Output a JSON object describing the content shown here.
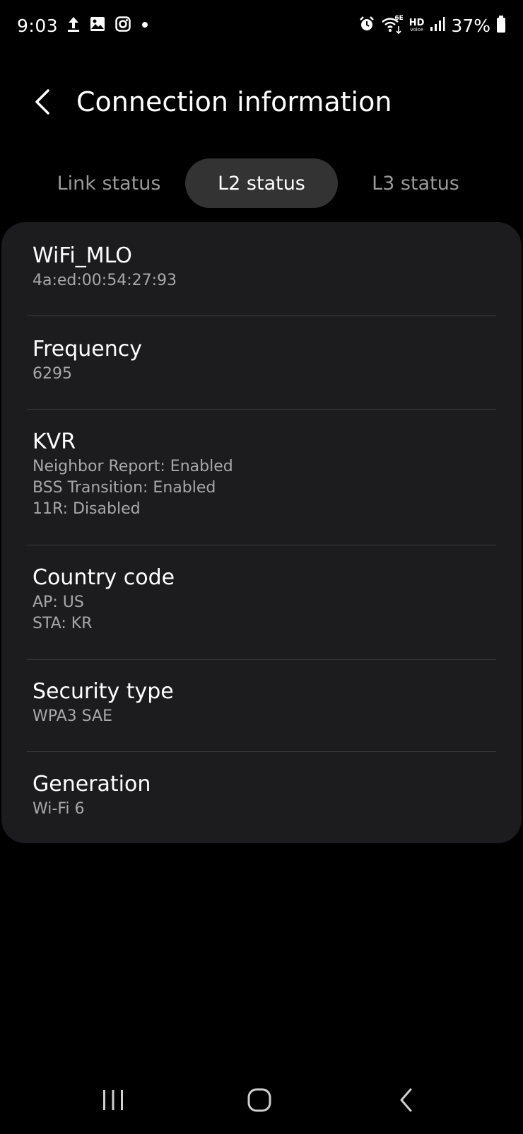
{
  "status_bar": {
    "time": "9:03",
    "battery_percent": "37%",
    "hd_label": "HD",
    "voice_label": "voice",
    "wifi_badge": "6E",
    "left_icons": [
      "upload-icon",
      "gallery-icon",
      "instagram-icon",
      "dot-icon"
    ],
    "right_icons": [
      "alarm-icon",
      "wifi-icon",
      "hd-voice-icon",
      "signal-icon",
      "battery-icon"
    ]
  },
  "header": {
    "title": "Connection information",
    "back_icon": "chevron-left-icon"
  },
  "tabs": [
    {
      "label": "Link status",
      "active": false
    },
    {
      "label": "L2 status",
      "active": true
    },
    {
      "label": "L3 status",
      "active": false
    }
  ],
  "details": [
    {
      "title": "WiFi_MLO",
      "values": [
        "4a:ed:00:54:27:93"
      ]
    },
    {
      "title": "Frequency",
      "values": [
        "6295"
      ]
    },
    {
      "title": "KVR",
      "values": [
        "Neighbor Report: Enabled",
        "BSS Transition: Enabled",
        "11R: Disabled"
      ]
    },
    {
      "title": "Country code",
      "values": [
        "AP: US",
        "STA: KR"
      ]
    },
    {
      "title": "Security type",
      "values": [
        "WPA3 SAE"
      ]
    },
    {
      "title": "Generation",
      "values": [
        "Wi-Fi 6"
      ]
    }
  ],
  "nav_bar": {
    "icons": [
      "recents-icon",
      "home-icon",
      "back-icon"
    ]
  },
  "colors": {
    "background": "#000000",
    "card": "#1c1c1e",
    "active_tab": "#333333",
    "secondary_text": "#a8a8a8"
  }
}
